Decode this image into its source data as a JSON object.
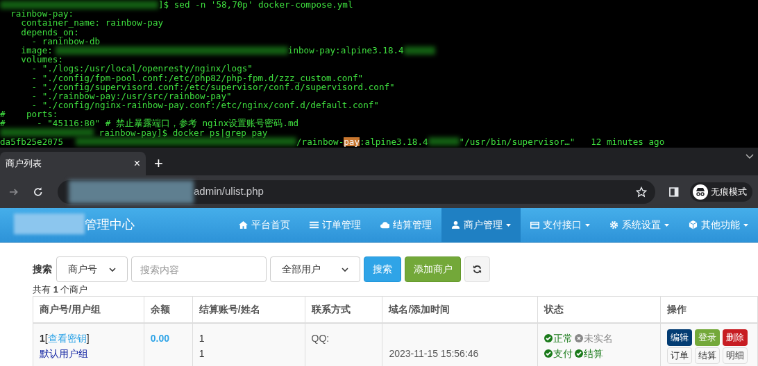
{
  "terminal": {
    "lines": [
      {
        "segments": [
          {
            "kind": "blur"
          },
          {
            "kind": "text",
            "text": "]$ sed -n '58,70p' docker-compose.yml"
          }
        ]
      },
      {
        "segments": [
          {
            "kind": "text",
            "text": "  rainbow-pay:"
          }
        ]
      },
      {
        "segments": [
          {
            "kind": "text",
            "text": "    container_name: rainbow-pay"
          }
        ]
      },
      {
        "segments": [
          {
            "kind": "text",
            "text": "    depends_on:"
          }
        ]
      },
      {
        "segments": [
          {
            "kind": "text",
            "text": "      - raninbow-db"
          }
        ]
      },
      {
        "segments": [
          {
            "kind": "text",
            "text": "    image:"
          },
          {
            "kind": "blur"
          },
          {
            "kind": "text",
            "text": "inbow-pay:alpine3.18.4"
          },
          {
            "kind": "blur"
          }
        ]
      },
      {
        "segments": [
          {
            "kind": "text",
            "text": "    volumes:"
          }
        ]
      },
      {
        "segments": [
          {
            "kind": "text",
            "text": "      - \"./logs:/usr/local/openresty/nginx/logs\""
          }
        ]
      },
      {
        "segments": [
          {
            "kind": "text",
            "text": "      - \"./config/fpm-pool.conf:/etc/php82/php-fpm.d/zzz_custom.conf\""
          }
        ]
      },
      {
        "segments": [
          {
            "kind": "text",
            "text": "      - \"./config/supervisord.conf:/etc/supervisor/conf.d/supervisord.conf\""
          }
        ]
      },
      {
        "segments": [
          {
            "kind": "text",
            "text": "      - \"./rainbow-pay:/usr/src/rainbow-pay\""
          }
        ]
      },
      {
        "segments": [
          {
            "kind": "text",
            "text": "      - \"./config/nginx-rainbow-pay.conf:/etc/nginx/conf.d/default.conf\""
          }
        ]
      },
      {
        "segments": [
          {
            "kind": "text",
            "text": "#    ports:"
          }
        ]
      },
      {
        "segments": [
          {
            "kind": "text",
            "text": "#      - \"45116:80\" # 禁止暴露端口，参考 nginx设置账号密码.md"
          }
        ]
      },
      {
        "segments": [
          {
            "kind": "blur"
          },
          {
            "kind": "text",
            "text": " rainbow-pay]$ docker ps|grep pay"
          }
        ]
      },
      {
        "segments": [
          {
            "kind": "text",
            "text": "da5fb25e2075"
          },
          {
            "kind": "blur"
          },
          {
            "kind": "text",
            "text": "/rainbow-"
          },
          {
            "kind": "mark",
            "text": "pay"
          },
          {
            "kind": "text",
            "text": ":alpine3.18.4"
          },
          {
            "kind": "blur"
          },
          {
            "kind": "text",
            "text": "\"/usr/bin/supervisor…\"   12 minutes ago"
          }
        ]
      }
    ]
  },
  "browser": {
    "tab": {
      "title": "商户列表",
      "close": "×",
      "selected": true
    },
    "new_tab": "+",
    "url": "admin/ulist.php",
    "incognito": "无痕模式"
  },
  "site": {
    "title": "管理中心",
    "nav": [
      {
        "label": "平台首页",
        "dropdown": false,
        "selected": false
      },
      {
        "label": "订单管理",
        "dropdown": false,
        "selected": false
      },
      {
        "label": "结算管理",
        "dropdown": false,
        "selected": false
      },
      {
        "label": "商户管理",
        "dropdown": true,
        "selected": true
      },
      {
        "label": "支付接口",
        "dropdown": true,
        "selected": false
      },
      {
        "label": "系统设置",
        "dropdown": true,
        "selected": false
      },
      {
        "label": "其他功能",
        "dropdown": true,
        "selected": false
      }
    ]
  },
  "search": {
    "label": "搜索",
    "field_select": "商户号",
    "placeholder": "搜索内容",
    "group_select": "全部用户",
    "search_button": "搜索",
    "add_button": "添加商户"
  },
  "summary": "共有 **1** 个商户",
  "table": {
    "columns": [
      "商户号/用户组",
      "余额",
      "结算账号/姓名",
      "联系方式",
      "域名/添加时间",
      "状态",
      "操作"
    ],
    "rows": [
      {
        "id": "1",
        "open_bracket": "[",
        "key_link": "查看密钥",
        "close_bracket": "]",
        "group": "默认用户组",
        "balance": "0.00",
        "account": "1",
        "name": "1",
        "contact": "QQ:",
        "domain_time": "2023-11-15 15:56:46",
        "status": [
          [
            {
              "label": "正常",
              "kind": "ok"
            },
            {
              "label": "未实名",
              "kind": "no"
            }
          ],
          [
            {
              "label": "支付",
              "kind": "ok"
            },
            {
              "label": "结算",
              "kind": "ok"
            }
          ]
        ],
        "actions": [
          [
            {
              "label": "编辑",
              "kind": "primary"
            },
            {
              "label": "登录",
              "kind": "success"
            },
            {
              "label": "删除",
              "kind": "danger"
            }
          ],
          [
            {
              "label": "订单",
              "kind": "default"
            },
            {
              "label": "结算",
              "kind": "default"
            },
            {
              "label": "明细",
              "kind": "default"
            }
          ]
        ]
      }
    ]
  }
}
